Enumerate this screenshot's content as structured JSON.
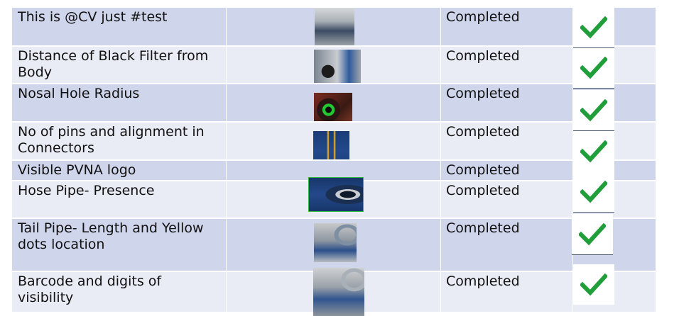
{
  "rows": [
    {
      "feature": "This is @CV just #test",
      "status": "Completed",
      "status_icon": "green-checkmark-icon"
    },
    {
      "feature": "Distance of Black Filter from Body",
      "status": "Completed",
      "status_icon": "green-checkmark-icon"
    },
    {
      "feature": "Nosal Hole Radius",
      "status": "Completed",
      "status_icon": "green-checkmark-icon"
    },
    {
      "feature": "No of pins and alignment in Connectors",
      "status": "Completed",
      "status_icon": "green-checkmark-icon"
    },
    {
      "feature": "Visible PVNA logo",
      "status": "Completed",
      "status_icon": "green-checkmark-icon"
    },
    {
      "feature": "Hose Pipe- Presence",
      "status": "Completed",
      "status_icon": "green-checkmark-icon"
    },
    {
      "feature": "Tail Pipe- Length and Yellow dots location",
      "status": "Completed",
      "status_icon": "green-checkmark-icon"
    },
    {
      "feature": "Barcode and digits of visibility",
      "status": "Completed",
      "status_icon": "green-checkmark-icon"
    }
  ],
  "colors": {
    "row_dark": "#cfd5ea",
    "row_light": "#e9ecf5",
    "check": "#1f9e3a"
  }
}
